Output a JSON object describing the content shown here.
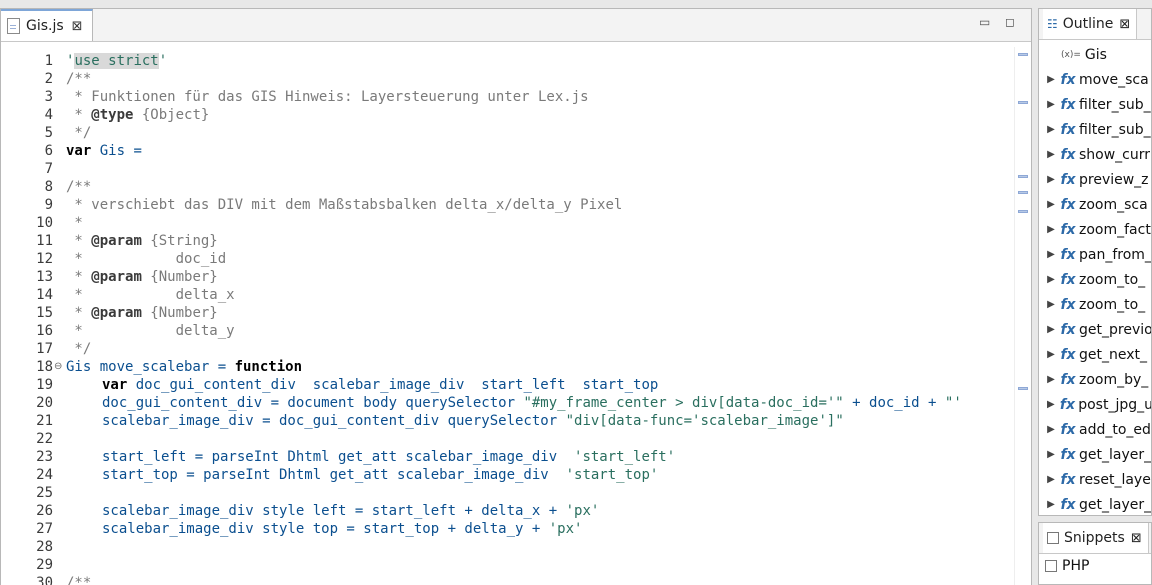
{
  "editor": {
    "tab_label": "Gis.js",
    "close_glyph": "⊠",
    "minimize_glyph": "▭",
    "maximize_glyph": "◻"
  },
  "code_lines": [
    {
      "n": "1",
      "parts": [
        {
          "c": "str",
          "t": "'"
        },
        {
          "c": "str hl",
          "t": "use strict"
        },
        {
          "c": "str",
          "t": "'"
        }
      ]
    },
    {
      "n": "2",
      "parts": [
        {
          "c": "cm",
          "t": "/**"
        }
      ]
    },
    {
      "n": "3",
      "parts": [
        {
          "c": "cm",
          "t": " * Funktionen für das GIS Hinweis: Layersteuerung unter Lex.js"
        }
      ]
    },
    {
      "n": "4",
      "parts": [
        {
          "c": "cm",
          "t": " * "
        },
        {
          "c": "tag",
          "t": "@type"
        },
        {
          "c": "cm",
          "t": " {Object}"
        }
      ]
    },
    {
      "n": "5",
      "parts": [
        {
          "c": "cm",
          "t": " */"
        }
      ]
    },
    {
      "n": "6",
      "parts": [
        {
          "c": "kw",
          "t": "var"
        },
        {
          "c": "var",
          "t": " Gis ="
        }
      ]
    },
    {
      "n": "7",
      "parts": []
    },
    {
      "n": "8",
      "parts": [
        {
          "c": "cm",
          "t": "/**"
        }
      ]
    },
    {
      "n": "9",
      "parts": [
        {
          "c": "cm",
          "t": " * verschiebt das DIV mit dem Maßstabsbalken delta_x/delta_y Pixel"
        }
      ]
    },
    {
      "n": "10",
      "parts": [
        {
          "c": "cm",
          "t": " *"
        }
      ]
    },
    {
      "n": "11",
      "parts": [
        {
          "c": "cm",
          "t": " * "
        },
        {
          "c": "tag",
          "t": "@param"
        },
        {
          "c": "cm",
          "t": " {String}"
        }
      ]
    },
    {
      "n": "12",
      "parts": [
        {
          "c": "cm",
          "t": " *           doc_id"
        }
      ]
    },
    {
      "n": "13",
      "parts": [
        {
          "c": "cm",
          "t": " * "
        },
        {
          "c": "tag",
          "t": "@param"
        },
        {
          "c": "cm",
          "t": " {Number}"
        }
      ]
    },
    {
      "n": "14",
      "parts": [
        {
          "c": "cm",
          "t": " *           delta_x"
        }
      ]
    },
    {
      "n": "15",
      "parts": [
        {
          "c": "cm",
          "t": " * "
        },
        {
          "c": "tag",
          "t": "@param"
        },
        {
          "c": "cm",
          "t": " {Number}"
        }
      ]
    },
    {
      "n": "16",
      "parts": [
        {
          "c": "cm",
          "t": " *           delta_y"
        }
      ]
    },
    {
      "n": "17",
      "parts": [
        {
          "c": "cm",
          "t": " */"
        }
      ]
    },
    {
      "n": "18",
      "fold": "⊖",
      "parts": [
        {
          "c": "var",
          "t": "Gis move_scalebar = "
        },
        {
          "c": "kw",
          "t": "function"
        }
      ]
    },
    {
      "n": "19",
      "ind": true,
      "parts": [
        {
          "c": "kw",
          "t": "var"
        },
        {
          "c": "var",
          "t": " doc_gui_content_div  scalebar_image_div  start_left  start_top"
        }
      ]
    },
    {
      "n": "20",
      "ind": true,
      "parts": [
        {
          "c": "var",
          "t": "doc_gui_content_div = document body querySelector "
        },
        {
          "c": "str",
          "t": "\"#my_frame_center > div[data-doc_id='\""
        },
        {
          "c": "var",
          "t": " + doc_id + "
        },
        {
          "c": "str",
          "t": "\"'"
        }
      ]
    },
    {
      "n": "21",
      "ind": true,
      "parts": [
        {
          "c": "var",
          "t": "scalebar_image_div = doc_gui_content_div querySelector "
        },
        {
          "c": "str",
          "t": "\"div[data-func='scalebar_image']\""
        }
      ]
    },
    {
      "n": "22",
      "parts": []
    },
    {
      "n": "23",
      "ind": true,
      "parts": [
        {
          "c": "var",
          "t": "start_left = parseInt Dhtml get_att scalebar_image_div  "
        },
        {
          "c": "str",
          "t": "'start_left'"
        }
      ]
    },
    {
      "n": "24",
      "ind": true,
      "parts": [
        {
          "c": "var",
          "t": "start_top = parseInt Dhtml get_att scalebar_image_div  "
        },
        {
          "c": "str",
          "t": "'start_top'"
        }
      ]
    },
    {
      "n": "25",
      "parts": []
    },
    {
      "n": "26",
      "ind": true,
      "parts": [
        {
          "c": "var",
          "t": "scalebar_image_div style left = start_left + delta_x + "
        },
        {
          "c": "str",
          "t": "'px'"
        }
      ]
    },
    {
      "n": "27",
      "ind": true,
      "parts": [
        {
          "c": "var",
          "t": "scalebar_image_div style top = start_top + delta_y + "
        },
        {
          "c": "str",
          "t": "'px'"
        }
      ]
    },
    {
      "n": "28",
      "parts": []
    },
    {
      "n": "29",
      "parts": []
    },
    {
      "n": "30",
      "parts": [
        {
          "c": "cm",
          "t": "/**"
        }
      ]
    }
  ],
  "outline": {
    "tab_label": "Outline",
    "close_glyph": "⊠",
    "root": {
      "label": "Gis",
      "icon": "variable-icon",
      "badge": "(x)="
    },
    "items": [
      "move_sca",
      "filter_sub_",
      "filter_sub_",
      "show_curr",
      "preview_z",
      "zoom_sca",
      "zoom_fact",
      "pan_from_",
      "zoom_to_",
      "zoom_to_",
      "get_previo",
      "get_next_",
      "zoom_by_",
      "post_jpg_u",
      "add_to_ed",
      "get_layer_",
      "reset_laye",
      "get_layer_"
    ]
  },
  "snippets": {
    "tab_label": "Snippets",
    "close_glyph": "⊠",
    "items": [
      "PHP"
    ]
  },
  "colors": {
    "accent": "#7ea6d8",
    "keyword": "#000000",
    "string": "#2a6f5f",
    "variable": "#0b4f8f",
    "comment": "#7a7a7a"
  }
}
